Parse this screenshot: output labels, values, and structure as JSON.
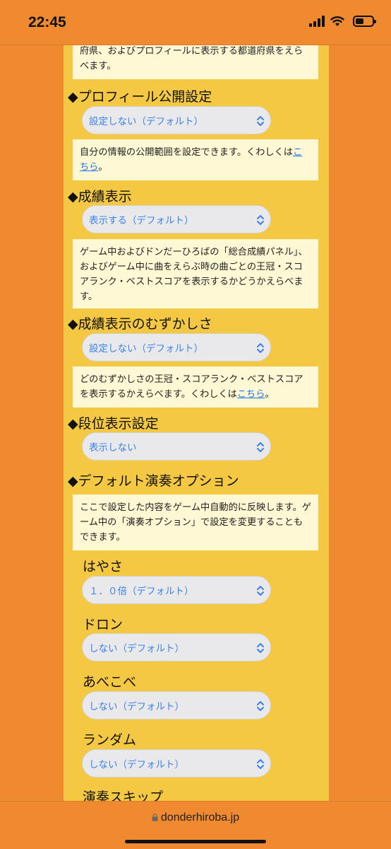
{
  "status_bar": {
    "time": "22:45"
  },
  "intro_box": {
    "text": "府県、およびプロフィールに表示する都道府県をえらべます。"
  },
  "sections": {
    "profile_public": {
      "heading": "◆プロフィール公開設定",
      "select_value": "設定しない（デフォルト）",
      "info_text": "自分の情報の公開範囲を設定できます。くわしくは",
      "info_link": "こちら",
      "info_suffix": "。"
    },
    "score_display": {
      "heading": "◆成績表示",
      "select_value": "表示する（デフォルト）",
      "info_text": "ゲーム中およびドンだーひろばの「総合成績パネル」、およびゲーム中に曲をえらぶ時の曲ごとの王冠・スコアランク・ベストスコアを表示するかどうかえらべます。"
    },
    "score_difficulty": {
      "heading": "◆成績表示のむずかしさ",
      "select_value": "設定しない（デフォルト）",
      "info_text": "どのむずかしさの王冠・スコアランク・ベストスコアを表示するかえらべます。くわしくは",
      "info_link": "こちら",
      "info_suffix": "。"
    },
    "dan_display": {
      "heading": "◆段位表示設定",
      "select_value": "表示しない"
    },
    "default_options": {
      "heading": "◆デフォルト演奏オプション",
      "info_text": "ここで設定した内容をゲーム中自動的に反映します。ゲーム中の「演奏オプション」で設定を変更することもできます。",
      "speed": {
        "label": "はやさ",
        "value": "１．０倍（デフォルト）"
      },
      "doron": {
        "label": "ドロン",
        "value": "しない（デフォルト）"
      },
      "abekobe": {
        "label": "あべこべ",
        "value": "しない（デフォルト）"
      },
      "random": {
        "label": "ランダム",
        "value": "しない（デフォルト）"
      },
      "skip": {
        "label": "演奏スキップ"
      }
    }
  },
  "browser": {
    "url": "donderhiroba.jp"
  },
  "colors": {
    "page_background": "#ef8a31",
    "panel_background": "#f4c842",
    "info_background": "#fff8d4",
    "select_text": "#3b82e6",
    "link": "#1a73e8"
  }
}
